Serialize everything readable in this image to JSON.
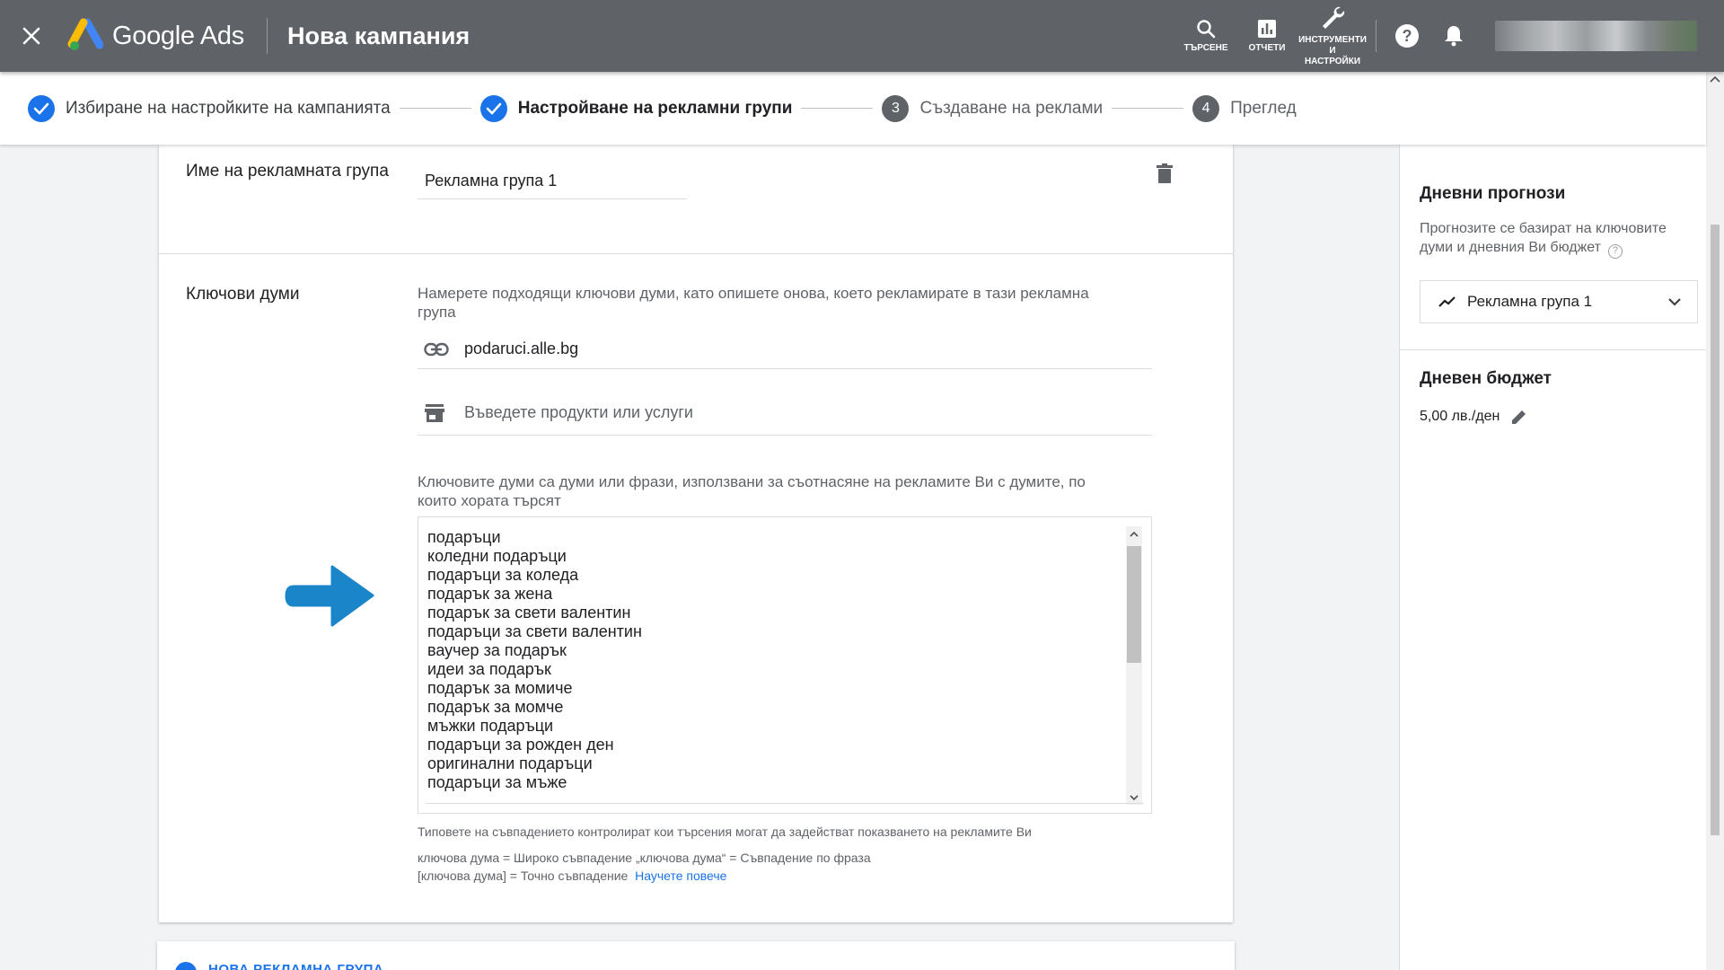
{
  "topbar": {
    "brand": "Google Ads",
    "title": "Нова кампания",
    "actions": {
      "search": "ТЪРСЕНЕ",
      "reports": "ОТЧЕТИ",
      "tools_line1": "ИНСТРУМЕНТИ",
      "tools_line2": "И",
      "tools_line3": "НАСТРОЙКИ"
    },
    "bar_color": "#5f6368"
  },
  "stepper": {
    "steps": [
      {
        "label": "Избиране на настройките на кампанията",
        "state": "done",
        "number": ""
      },
      {
        "label": "Настройване на рекламни групи",
        "state": "current",
        "number": ""
      },
      {
        "label": "Създаване на реклами",
        "state": "future",
        "number": "3"
      },
      {
        "label": "Преглед",
        "state": "future",
        "number": "4"
      }
    ]
  },
  "adgroup": {
    "name_label": "Име на рекламната група",
    "name_value": "Рекламна група 1"
  },
  "keywords": {
    "section_label": "Ключови думи",
    "hint_line1": "Намерете подходящи ключови думи, като опишете онова, което рекламирате в тази рекламна",
    "hint_line2": "група",
    "url_value": "podaruci.alle.bg",
    "product_placeholder": "Въведете продукти или услуги",
    "list_hint_line1": "Ключовите думи са думи или фрази, използвани за съотнасяне на рекламите Ви с думите, по",
    "list_hint_line2": "които хората търсят",
    "items": [
      "подаръци",
      "коледни подаръци",
      "подаръци за коледа",
      "подарък за жена",
      "подарък за свети валентин",
      "подаръци за свети валентин",
      "ваучер за подарък",
      "идеи за подарък",
      "подарък за момиче",
      "подарък за момче",
      "мъжки подаръци",
      "подаръци за рожден ден",
      "оригинални подаръци",
      "подаръци за мъже"
    ],
    "match_note": "Типовете на съвпадението контролират кои търсения могат да задействат показването на рекламите Ви",
    "match_line1": "ключова дума = Широко съвпадение  „ключова дума“ = Съвпадение по фраза",
    "match_line2": "[ключова дума] = Точно съвпадение",
    "learn_more": "Научете повече"
  },
  "new_adgroup": {
    "label": "НОВА РЕКЛАМНА ГРУПА"
  },
  "right_panel": {
    "forecast_title": "Дневни прогнози",
    "forecast_sub": "Прогнозите се базират на ключовите думи и дневния Ви бюджет",
    "help_glyph": "?",
    "selected_group": "Рекламна група 1",
    "budget_title": "Дневен бюджет",
    "budget_value": "5,00 лв./ден"
  },
  "colors": {
    "accent": "#1a73e8",
    "arrow": "#1a85c8"
  }
}
